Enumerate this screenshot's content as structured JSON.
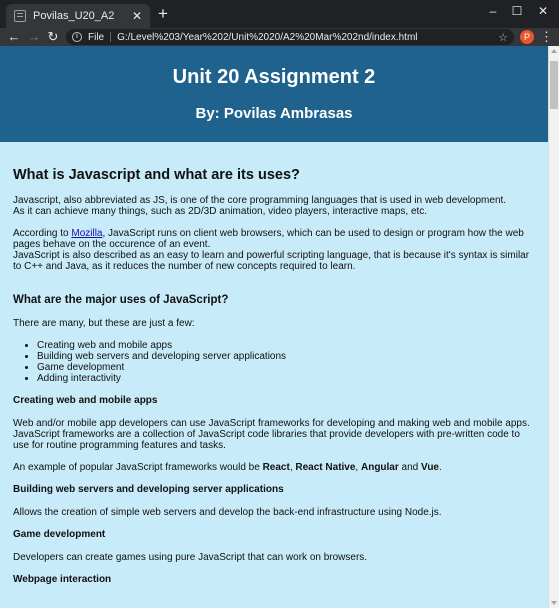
{
  "browser": {
    "tab_title": "Povilas_U20_A2",
    "tab_close": "✕",
    "new_tab": "+",
    "window_controls": {
      "minimize": "–",
      "maximize": "☐",
      "close": "✕"
    },
    "nav": {
      "back": "←",
      "forward": "→",
      "reload": "↻"
    },
    "address": {
      "info": "i",
      "scheme": "File",
      "url": "G:/Level%203/Year%202/Unit%2020/A2%20Mar%202nd/index.html",
      "star": "☆"
    },
    "profile_initial": "P",
    "menu": "⋮"
  },
  "page": {
    "title": "Unit 20 Assignment 2",
    "byline": "By: Povilas Ambrasas",
    "sections": {
      "intro_heading": "What is Javascript and what are its uses?",
      "intro_line1": "Javascript, also abbreviated as JS, is one of the core programming languages that is used in web development.",
      "intro_line2": "As it can achieve many things, such as 2D/3D animation, video players, interactive maps, etc.",
      "according_prefix": "According to ",
      "mozilla_link": "Mozilla",
      "according_rest": ", JavaScript runs on client web browsers, which can be used to design or program how the web pages behave on the occurence of an event.",
      "easy_to_learn": "JavaScript is also described as an easy to learn and powerful scripting language, that is because it's syntax is similar to C++ and Java, as it reduces the number of new concepts required to learn.",
      "uses_heading": "What are the major uses of JavaScript?",
      "uses_intro": "There are many, but these are just a few:",
      "uses_list": [
        "Creating web and mobile apps",
        "Building web servers and developing server applications",
        "Game development",
        "Adding interactivity"
      ],
      "apps_heading": "Creating web and mobile apps",
      "apps_p1": "Web and/or mobile app developers can use JavaScript frameworks for developing and making web and mobile apps. JavaScript frameworks are a collection of JavaScript code libraries that provide developers with pre-written code to use for routine programming features and tasks.",
      "frameworks_prefix": "An example of popular JavaScript frameworks would be ",
      "fw_react": "React",
      "fw_comma1": ", ",
      "fw_react_native": "React Native",
      "fw_comma2": ", ",
      "fw_angular": "Angular",
      "fw_and": " and ",
      "fw_vue": "Vue",
      "fw_end": ".",
      "servers_heading": "Building web servers and developing server applications",
      "servers_p": "Allows the creation of simple web servers and develop the back-end infrastructure using Node.js.",
      "games_heading": "Game development",
      "games_p": "Developers can create games using pure JavaScript that can work on browsers.",
      "interaction_heading": "Webpage interaction"
    }
  }
}
